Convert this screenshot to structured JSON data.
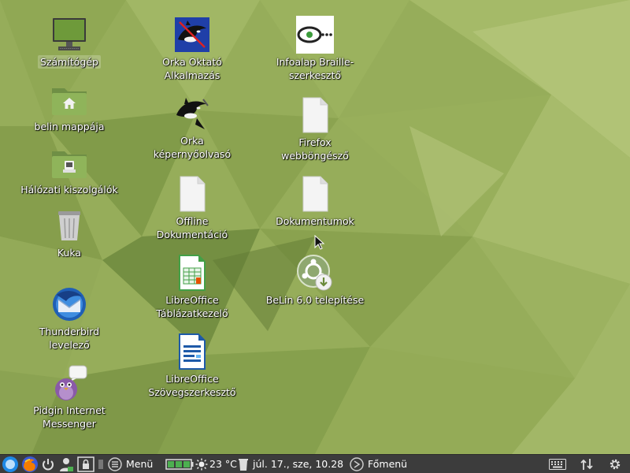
{
  "desktop_icons": {
    "computer": "Számítógép",
    "home_folder": "belin mappája",
    "network": "Hálózati kiszolgálók",
    "trash": "Kuka",
    "thunderbird": [
      "Thunderbird",
      "levelező"
    ],
    "pidgin": [
      "Pidgin Internet",
      "Messenger"
    ],
    "orca_tutorial": [
      "Orka Oktató",
      "Alkalmazás"
    ],
    "orca_reader": [
      "Orka",
      "képernyőolvasó"
    ],
    "offline_docs": [
      "Offline",
      "Dokumentáció"
    ],
    "calc": [
      "LibreOffice",
      "Táblázatkezelő"
    ],
    "writer": [
      "LibreOffice",
      "Szövegszerkesztő"
    ],
    "braille": [
      "Infoalap Braille-",
      "szerkesztő"
    ],
    "firefox": [
      "Firefox",
      "webböngésző"
    ],
    "documents": "Dokumentumok",
    "installer": "BeLin 6.0 telepítése"
  },
  "taskbar": {
    "menu_label": "Menü",
    "temperature": "23 °C",
    "clock": "júl. 17., sze, 10.28",
    "main_menu_label": "Főmenü"
  },
  "colors": {
    "wallpaper_base": "#96ad5a",
    "taskbar_bg": "#3c3c3c"
  }
}
